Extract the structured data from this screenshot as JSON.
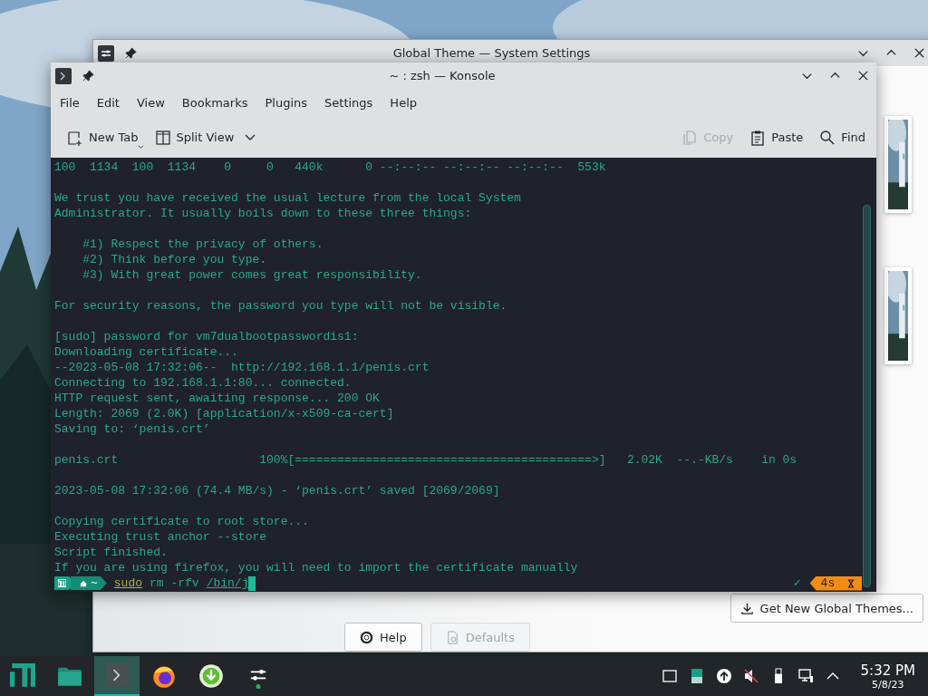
{
  "settings_window": {
    "title": "Global Theme — System Settings",
    "get_new_button": "Get New Global Themes...",
    "footer_buttons": [
      {
        "label": "Help",
        "kind": "help",
        "disabled": false
      },
      {
        "label": "Defaults",
        "kind": "defaults",
        "disabled": true
      }
    ]
  },
  "konsole": {
    "title": "~ : zsh — Konsole",
    "menu": [
      "File",
      "Edit",
      "View",
      "Bookmarks",
      "Plugins",
      "Settings",
      "Help"
    ],
    "toolbar": [
      {
        "label": "New Tab",
        "kind": "new-tab",
        "disabled": false
      },
      {
        "label": "Split View",
        "kind": "split-view",
        "disabled": false
      },
      {
        "label": "Copy",
        "kind": "copy",
        "disabled": true
      },
      {
        "label": "Paste",
        "kind": "paste",
        "disabled": false
      },
      {
        "label": "Find",
        "kind": "find",
        "disabled": false
      }
    ],
    "terminal": {
      "blocks": [
        [
          "100  1134  100  1134    0     0   440k      0 --:--:-- --:--:-- --:--:--  553k"
        ],
        [
          "We trust you have received the usual lecture from the local System",
          "Administrator. It usually boils down to these three things:"
        ],
        [
          "    #1) Respect the privacy of others.",
          "    #2) Think before you type.",
          "    #3) With great power comes great responsibility."
        ],
        [
          "For security reasons, the password you type will not be visible."
        ],
        [
          "[sudo] password for vm7dualbootpasswordis1:",
          "Downloading certificate...",
          "--2023-05-08 17:32:06--  http://192.168.1.1/penis.crt",
          "Connecting to 192.168.1.1:80... connected.",
          "HTTP request sent, awaiting response... 200 OK",
          "Length: 2069 (2.0K) [application/x-x509-ca-cert]",
          "Saving to: ‘penis.crt’"
        ],
        [
          "penis.crt                    100%[==========================================>]   2.02K  --.-KB/s    in 0s"
        ],
        [
          "2023-05-08 17:32:06 (74.4 MB/s) - ‘penis.crt’ saved [2069/2069]"
        ],
        [
          "Copying certificate to root store...",
          "Executing trust anchor --store",
          "Script finished.",
          "If you are using firefox, you will need to import the certificate manually"
        ]
      ],
      "prompt": {
        "dir": "~",
        "command": "sudo",
        "args": "rm -rfv",
        "path": "/bin/j",
        "status": "✓",
        "duration": "4s"
      }
    }
  },
  "taskbar": {
    "apps": [
      {
        "kind": "manjaro",
        "active": false
      },
      {
        "kind": "files",
        "active": false
      },
      {
        "kind": "terminal",
        "active": true
      },
      {
        "kind": "browser",
        "active": false
      },
      {
        "kind": "download",
        "active": false
      },
      {
        "kind": "settings",
        "active": false
      }
    ],
    "clock": {
      "time": "5:32 PM",
      "date": "5/8/23"
    }
  }
}
